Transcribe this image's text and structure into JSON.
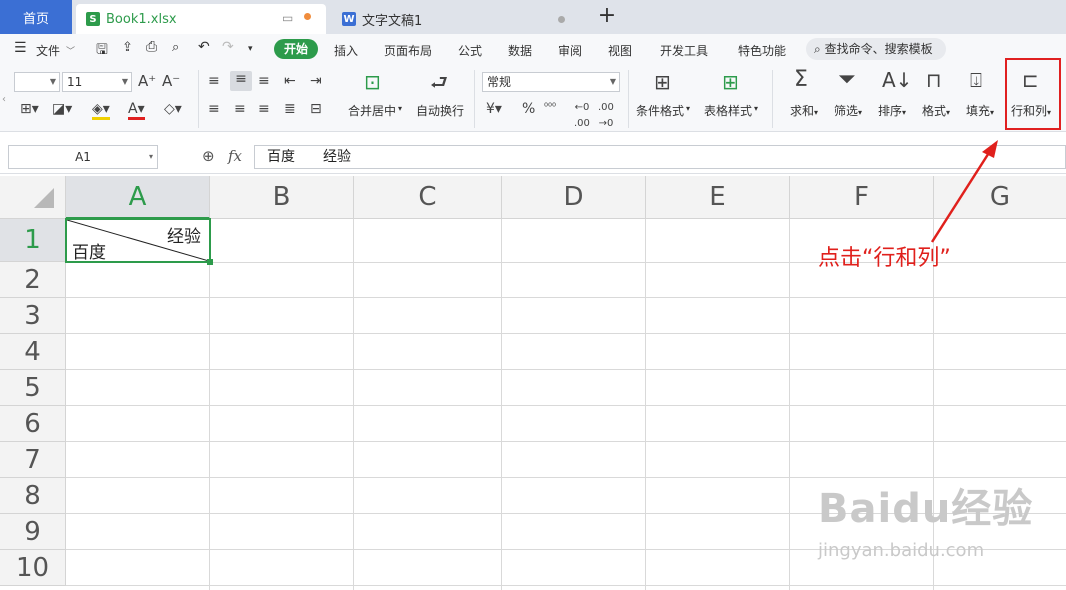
{
  "tabs": {
    "home": "首页",
    "book": "Book1.xlsx",
    "doc": "文字文稿1",
    "book_icon": "S",
    "doc_icon": "W"
  },
  "menu": {
    "file": "文件",
    "items": [
      "开始",
      "插入",
      "页面布局",
      "公式",
      "数据",
      "审阅",
      "视图",
      "开发工具",
      "特色功能"
    ],
    "search": "查找命令、搜索模板"
  },
  "ribbon": {
    "font_name": "",
    "font_size": "11",
    "number_format": "常规",
    "merge": "合并居中",
    "wrap": "自动换行",
    "cond_format": "条件格式",
    "table_style": "表格样式",
    "sum": "求和",
    "filter": "筛选",
    "sort": "排序",
    "format": "格式",
    "fill": "填充",
    "rowcol": "行和列",
    "currency": "¥",
    "percent": "%"
  },
  "formula": {
    "namebox": "A1",
    "fx": "fx",
    "content": "百度　　经验"
  },
  "sheet": {
    "columns": [
      "A",
      "B",
      "C",
      "D",
      "E",
      "F",
      "G"
    ],
    "rows": [
      "1",
      "2",
      "3",
      "4",
      "5",
      "6",
      "7",
      "8",
      "9",
      "10"
    ],
    "a1_top": "经验",
    "a1_bottom": "百度"
  },
  "annotation": "点击“行和列”",
  "watermark": {
    "brand": "Baidu经验",
    "url": "jingyan.baidu.com"
  },
  "colors": {
    "accent": "#2d9b4b",
    "home_tab": "#3b6fd4",
    "annotation": "#e0201c"
  }
}
